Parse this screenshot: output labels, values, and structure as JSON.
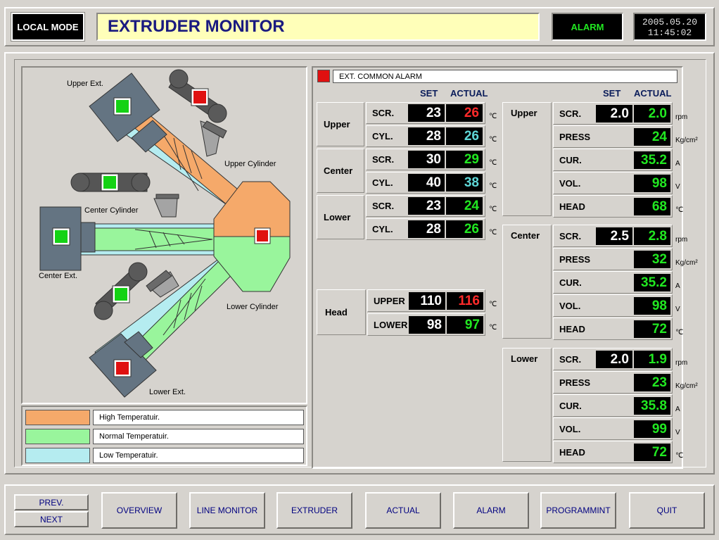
{
  "header": {
    "mode": "LOCAL MODE",
    "title": "EXTRUDER MONITOR",
    "alarm": "ALARM",
    "date": "2005.05.20",
    "time": "11:45:02"
  },
  "diagram": {
    "upper_ext": "Upper Ext.",
    "upper_cyl": "Upper Cylinder",
    "center_cyl": "Center Cylinder",
    "center_ext": "Center Ext.",
    "lower_cyl": "Lower Cylinder",
    "lower_ext": "Lower Ext."
  },
  "legend": {
    "high": "High Temperatuir.",
    "normal": "Normal Temperatuir.",
    "low": "Low Temperatuir.",
    "colors": {
      "high": "#f5a96a",
      "normal": "#99f59c",
      "low": "#b5ecf0"
    }
  },
  "common_alarm": "EXT. COMMON ALARM",
  "temp": {
    "col_set": "SET",
    "col_actual": "ACTUAL",
    "unit": "℃",
    "groups": [
      {
        "name": "Upper",
        "rows": [
          {
            "label": "SCR.",
            "set": "23",
            "actual": "26"
          },
          {
            "label": "CYL.",
            "set": "28",
            "actual": "26"
          }
        ]
      },
      {
        "name": "Center",
        "rows": [
          {
            "label": "SCR.",
            "set": "30",
            "actual": "29"
          },
          {
            "label": "CYL.",
            "set": "40",
            "actual": "38"
          }
        ]
      },
      {
        "name": "Lower",
        "rows": [
          {
            "label": "SCR.",
            "set": "23",
            "actual": "24"
          },
          {
            "label": "CYL.",
            "set": "28",
            "actual": "26"
          }
        ]
      }
    ]
  },
  "head": {
    "name": "Head",
    "rows": [
      {
        "label": "UPPER",
        "set": "110",
        "actual": "116"
      },
      {
        "label": "LOWER",
        "set": "98",
        "actual": "97"
      }
    ]
  },
  "right": {
    "col_set": "SET",
    "col_actual": "ACTUAL",
    "groups": [
      {
        "name": "Upper",
        "scr": {
          "label": "SCR.",
          "set": "2.0",
          "actual": "2.0",
          "unit": "rpm"
        },
        "press": {
          "label": "PRESS",
          "actual": "24",
          "unit": "Kg/cm²"
        },
        "cur": {
          "label": "CUR.",
          "actual": "35.2",
          "unit": "A"
        },
        "vol": {
          "label": "VOL.",
          "actual": "98",
          "unit": "V"
        },
        "head": {
          "label": "HEAD",
          "actual": "68",
          "unit": "℃"
        }
      },
      {
        "name": "Center",
        "scr": {
          "label": "SCR.",
          "set": "2.5",
          "actual": "2.8",
          "unit": "rpm"
        },
        "press": {
          "label": "PRESS",
          "actual": "32",
          "unit": "Kg/cm²"
        },
        "cur": {
          "label": "CUR.",
          "actual": "35.2",
          "unit": "A"
        },
        "vol": {
          "label": "VOL.",
          "actual": "98",
          "unit": "V"
        },
        "head": {
          "label": "HEAD",
          "actual": "72",
          "unit": "℃"
        }
      },
      {
        "name": "Lower",
        "scr": {
          "label": "SCR.",
          "set": "2.0",
          "actual": "1.9",
          "unit": "rpm"
        },
        "press": {
          "label": "PRESS",
          "actual": "23",
          "unit": "Kg/cm²"
        },
        "cur": {
          "label": "CUR.",
          "actual": "35.8",
          "unit": "A"
        },
        "vol": {
          "label": "VOL.",
          "actual": "99",
          "unit": "V"
        },
        "head": {
          "label": "HEAD",
          "actual": "72",
          "unit": "℃"
        }
      }
    ]
  },
  "footer": {
    "prev": "PREV.",
    "next": "NEXT",
    "buttons": [
      "OVERVIEW",
      "LINE MONITOR",
      "EXTRUDER",
      "ACTUAL",
      "ALARM",
      "PROGRAMMINT",
      "QUIT"
    ]
  }
}
